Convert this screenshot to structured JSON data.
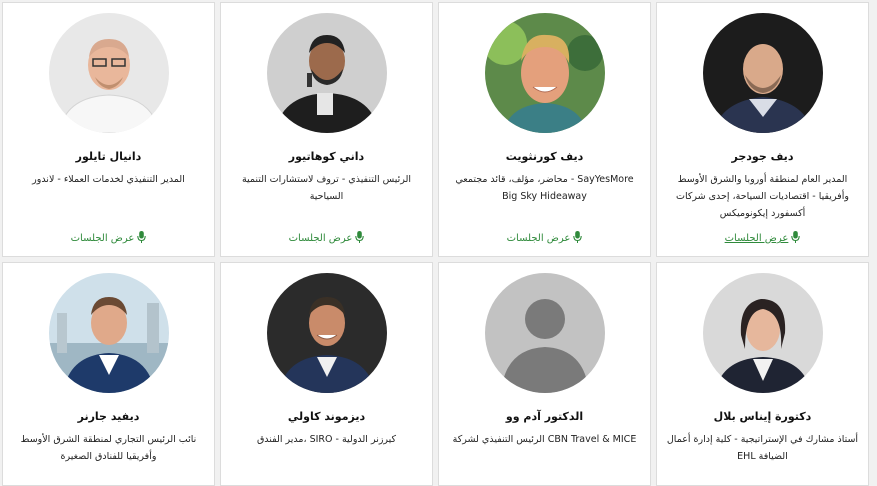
{
  "colors": {
    "accent": "#2f8a3b",
    "card_border": "#dcdcdc"
  },
  "sessions_icon": "microphone-icon",
  "speakers_row1": [
    {
      "name": "ديف جودجر",
      "title": "المدير العام لمنطقة أوروبا والشرق الأوسط وأفريقيا - اقتصاديات السياحة، إحدى شركات أكسفورد إيكونوميكس",
      "sessions_label": "عرض الجلسات"
    },
    {
      "name": "ديف كورنثويت",
      "title": "SayYesMore - محاضر، مؤلف، قائد مجتمعي Big Sky Hideaway",
      "sessions_label": "عرض الجلسات"
    },
    {
      "name": "داني كوهاتيور",
      "title": "الرئيس التنفيذي - تروف لاستشارات التنمية السياحية",
      "sessions_label": "عرض الجلسات"
    },
    {
      "name": "دانيال تايلور",
      "title": "المدير التنفيذي لخدمات العملاء - لاندور",
      "sessions_label": "عرض الجلسات"
    }
  ],
  "speakers_row2": [
    {
      "name": "دكتورة إيناس بلال",
      "title": "أستاذ مشارك في الإستراتيجية - كلية إدارة أعمال الضيافة EHL"
    },
    {
      "name": "الدكتور آدم وو",
      "title": "CBN Travel & MICE الرئيس التنفيذي لشركة"
    },
    {
      "name": "ديزموند كاولي",
      "title": "كيرزنر الدولية - SIRO ،مدير الفندق"
    },
    {
      "name": "ديفيد جارنر",
      "title": "نائب الرئيس التجاري لمنطقة الشرق الأوسط وأفريقيا للفنادق الصغيرة"
    }
  ]
}
